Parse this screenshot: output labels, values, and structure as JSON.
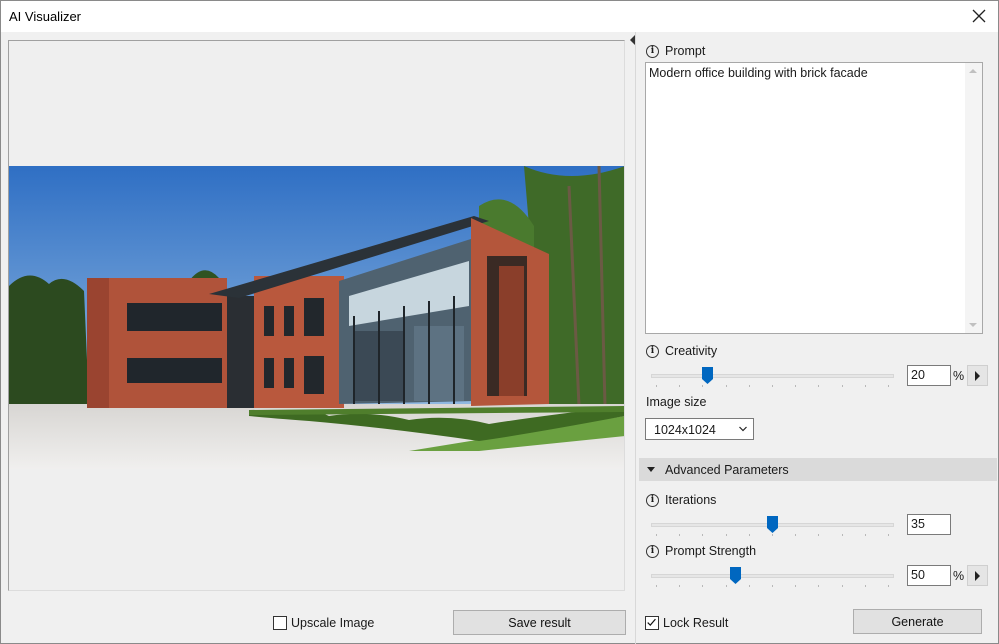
{
  "window": {
    "title": "AI Visualizer"
  },
  "preview": {
    "image_description": ""
  },
  "bottom_left": {
    "upscale_label": "Upscale Image",
    "upscale_checked": false,
    "save_label": "Save result"
  },
  "panel": {
    "prompt_label": "Prompt",
    "prompt_value": "Modern office building with brick facade",
    "creativity_label": "Creativity",
    "creativity_value": "20",
    "creativity_unit": "%",
    "image_size_label": "Image size",
    "image_size_value": "1024x1024",
    "advanced_label": "Advanced Parameters",
    "iterations_label": "Iterations",
    "iterations_value": "35",
    "strength_label": "Prompt Strength",
    "strength_value": "50",
    "strength_unit": "%",
    "lock_label": "Lock Result",
    "lock_checked": true,
    "generate_label": "Generate"
  },
  "sliders": {
    "creativity_fraction": 0.22,
    "iterations_fraction": 0.5,
    "strength_fraction": 0.34
  },
  "colors": {
    "accent": "#0067c0"
  }
}
